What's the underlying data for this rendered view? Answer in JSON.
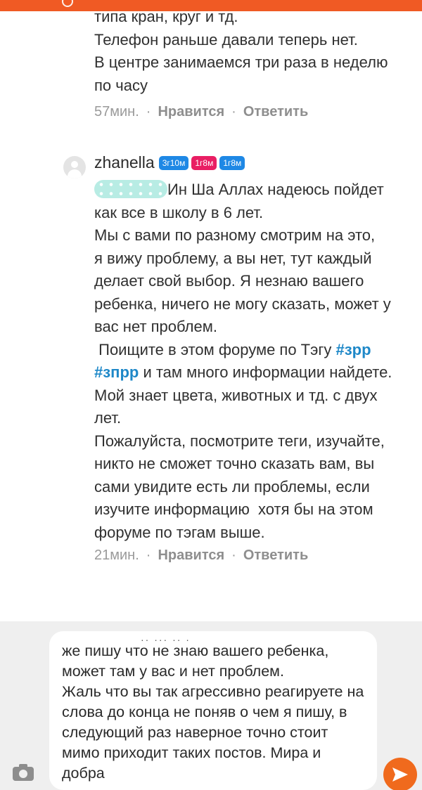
{
  "comments": [
    {
      "lines": [
        "типа кран, круг и тд.",
        "Телефон раньше давали теперь нет.",
        "В центре занимаемся три раза в неделю",
        "по часу"
      ],
      "time": "57мин.",
      "like_label": "Нравится",
      "reply_label": "Ответить"
    },
    {
      "username": "zhanella",
      "badges": [
        "3г10м",
        "1г8м",
        "1г8м"
      ],
      "mention_first_line": "Ин Ша Аллах надеюсь пойдет",
      "lines": [
        "как все в школу в 6 лет.",
        "Мы с вами по разному смотрим на это,",
        "я вижу проблему, а вы нет, тут каждый",
        "делает свой выбор. Я незнаю вашего",
        "ребенка, ничего не могу сказать, может у",
        "вас нет проблем."
      ],
      "search_prefix": " Поищите в этом форуме по Тэгу ",
      "tag1": "#зрр",
      "tag2": "#зпрр",
      "tag_suffix": " и там много информации найдете.",
      "lines2": [
        "Мой знает цвета, животных и тд. с двух",
        "лет.",
        "Пожалуйста, посмотрите теги, изучайте,",
        "никто не сможет точно сказать вам, вы",
        "сами увидите есть ли проблемы, если",
        "изучите информацию  хотя бы на этом",
        "форуме по тэгам выше."
      ],
      "time": "21мин.",
      "like_label": "Нравится",
      "reply_label": "Ответить"
    }
  ],
  "reply_input": {
    "value": "же пишу что не знаю вашего ребенка, может там у вас и нет проблем.\nЖаль что вы так агрессивно реагируете на слова до конца не поняв о чем я пишу, в следующий раз наверное точно стоит мимо приходит таких постов. Мира и добра"
  },
  "colors": {
    "accent": "#f06a1d",
    "tag": "#1e88c8",
    "badge_blue": "#1e88e5",
    "badge_pink": "#e91e63"
  },
  "icons": {
    "attach": "camera-icon",
    "send": "send-arrow-icon",
    "avatar": "default-user-avatar-icon"
  }
}
